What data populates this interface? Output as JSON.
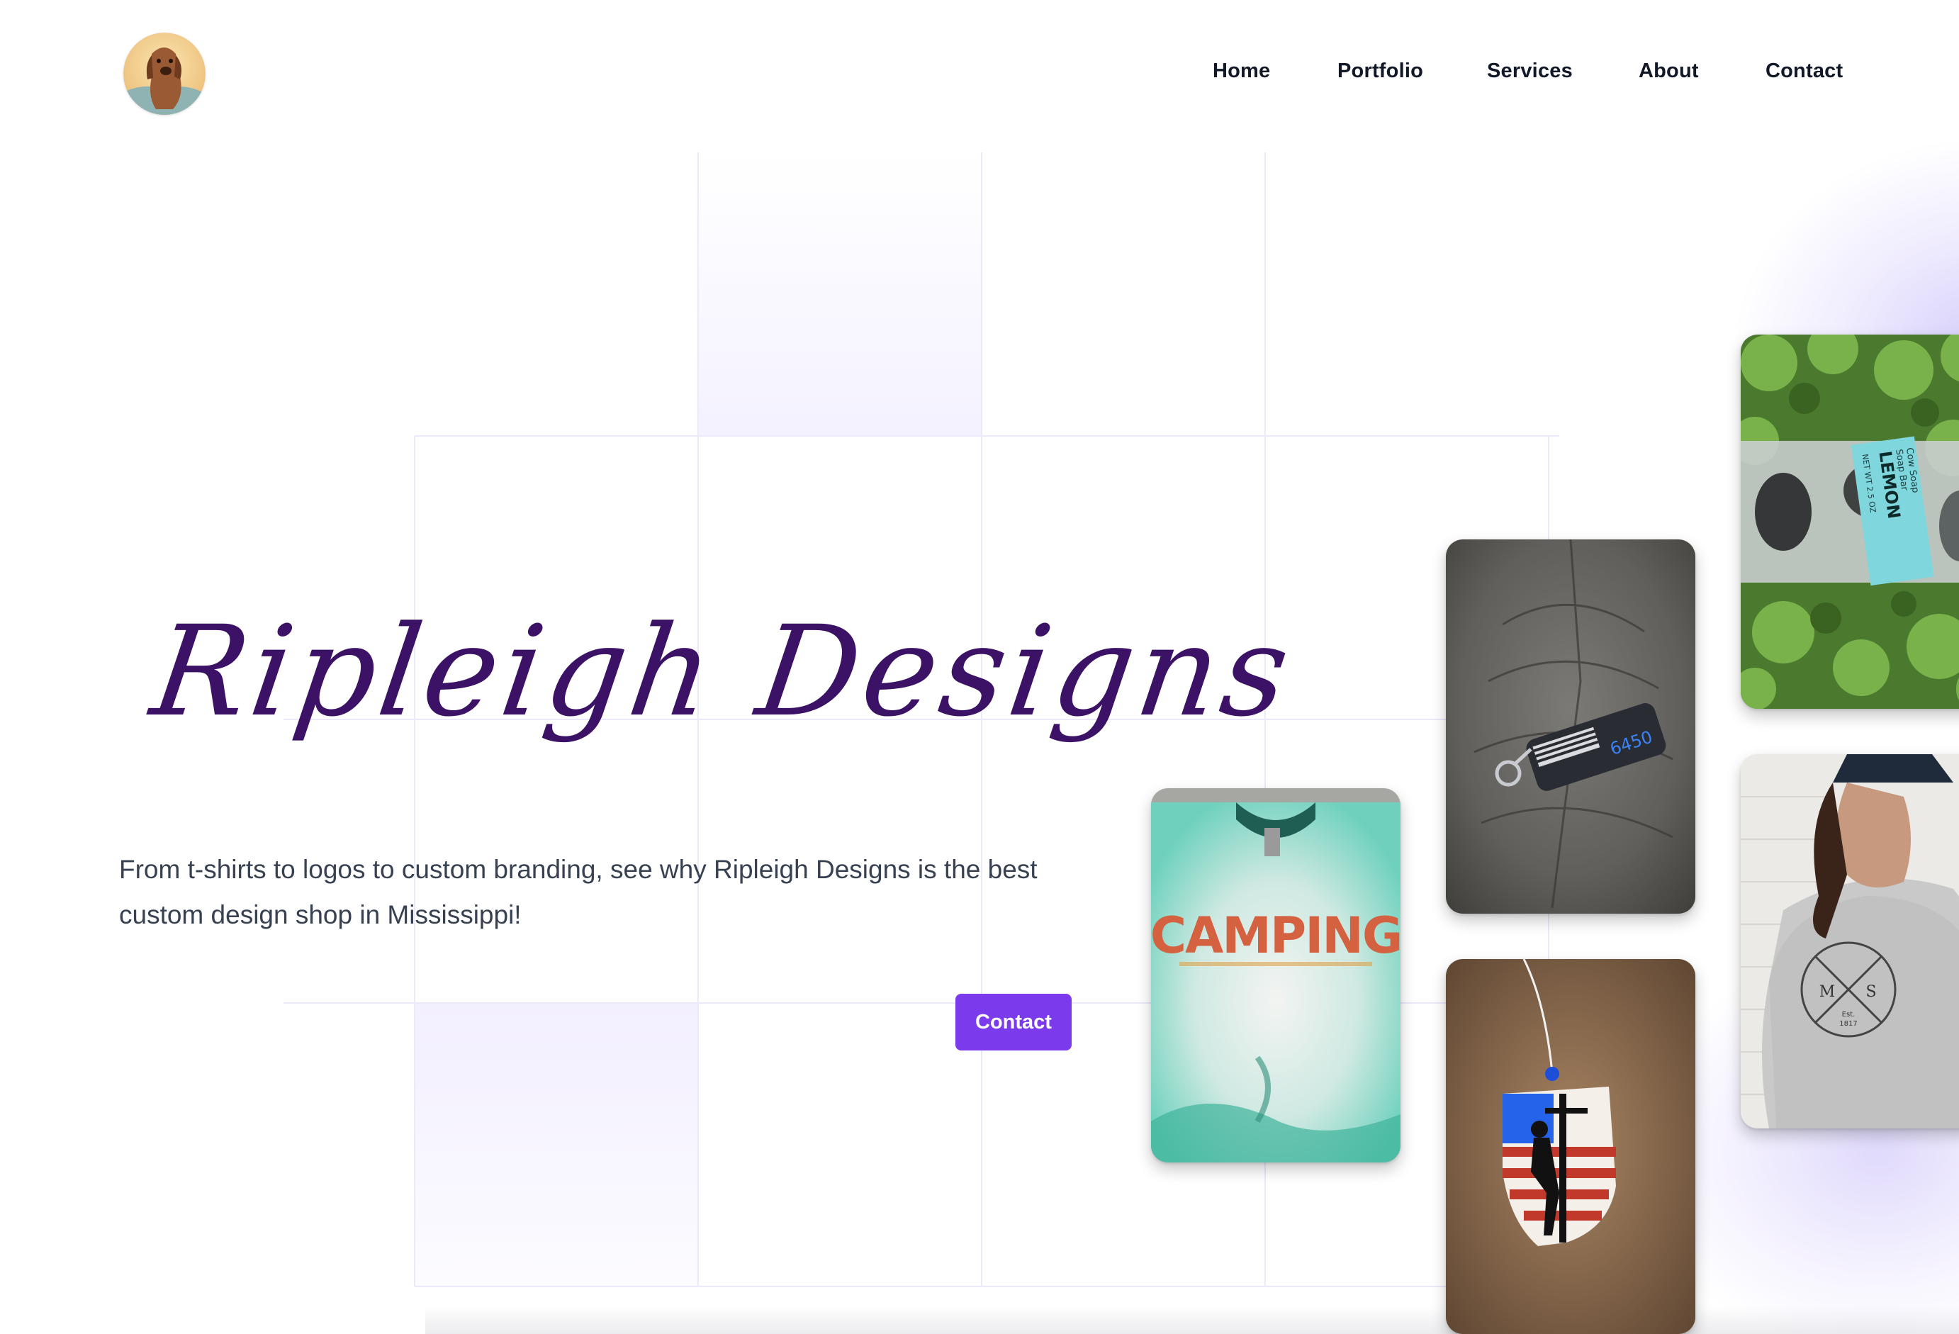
{
  "brand": {
    "logo_icon": "dog-portrait-logo-icon",
    "name": "Ripleigh Designs"
  },
  "nav": {
    "items": [
      {
        "label": "Home"
      },
      {
        "label": "Portfolio"
      },
      {
        "label": "Services"
      },
      {
        "label": "About"
      },
      {
        "label": "Contact"
      }
    ]
  },
  "hero": {
    "title": "Ripleigh Designs",
    "subtitle": "From t-shirts to logos to custom branding, see why Ripleigh Designs is the best custom design shop in Mississippi!",
    "cta_label": "Contact"
  },
  "gallery": {
    "camping_shirt": {
      "print_text": "CAMPING",
      "icon": "tshirt-photo"
    },
    "keychain": {
      "tag_text": "6450",
      "icon": "flag-keychain-photo"
    },
    "ornament": {
      "icon": "lineman-flag-ornament-photo"
    },
    "soap": {
      "label_line1": "Cow Soap",
      "label_line2": "Soap Bar",
      "label_line3": "LEMON",
      "label_line4": "NET WT 2.5 OZ",
      "icon": "soap-bar-photo"
    },
    "sweatshirt": {
      "letter_left": "M",
      "letter_right": "S",
      "est_line1": "Est.",
      "est_line2": "1817",
      "icon": "sweatshirt-photo"
    }
  },
  "colors": {
    "accent": "#7c3aed",
    "title": "#3b1266",
    "nav_text": "#111827",
    "body_text": "#374151"
  }
}
